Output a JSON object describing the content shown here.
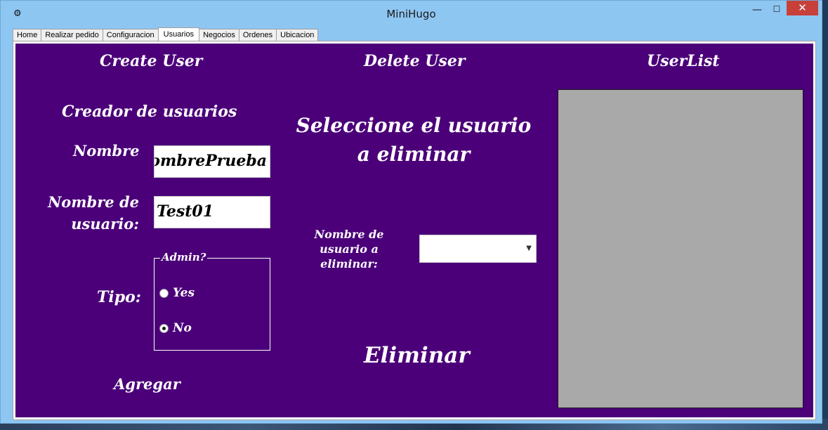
{
  "window": {
    "title": "MiniHugo",
    "controls": {
      "minimize": "—",
      "maximize": "☐",
      "close": "✕"
    }
  },
  "tabs": [
    "Home",
    "Realizar pedido",
    "Configuracion",
    "Usuarios",
    "Negocios",
    "Ordenes",
    "Ubicacion"
  ],
  "active_tab": "Usuarios",
  "headers": {
    "create": "Create User",
    "delete": "Delete User",
    "userlist": "UserList"
  },
  "create_user": {
    "section_title": "Creador de usuarios",
    "nombre_label": "Nombre",
    "nombre_value": "NombrePrueba",
    "username_label": "Nombre de usuario:",
    "username_value": "Test01",
    "tipo_label": "Tipo:",
    "admin_group_label": "Admin?",
    "radio_yes": "Yes",
    "radio_no": "No",
    "selected_radio": "No",
    "submit_label": "Agregar"
  },
  "delete_user": {
    "title": "Seleccione el usuario a eliminar",
    "select_label": "Nombre de usuario a eliminar:",
    "select_value": "",
    "submit_label": "Eliminar"
  },
  "colors": {
    "panel_background": "#4b0079",
    "userlist_background": "#a9a9a9",
    "titlebar": "#8ec6f2",
    "close_button": "#c7403a"
  }
}
